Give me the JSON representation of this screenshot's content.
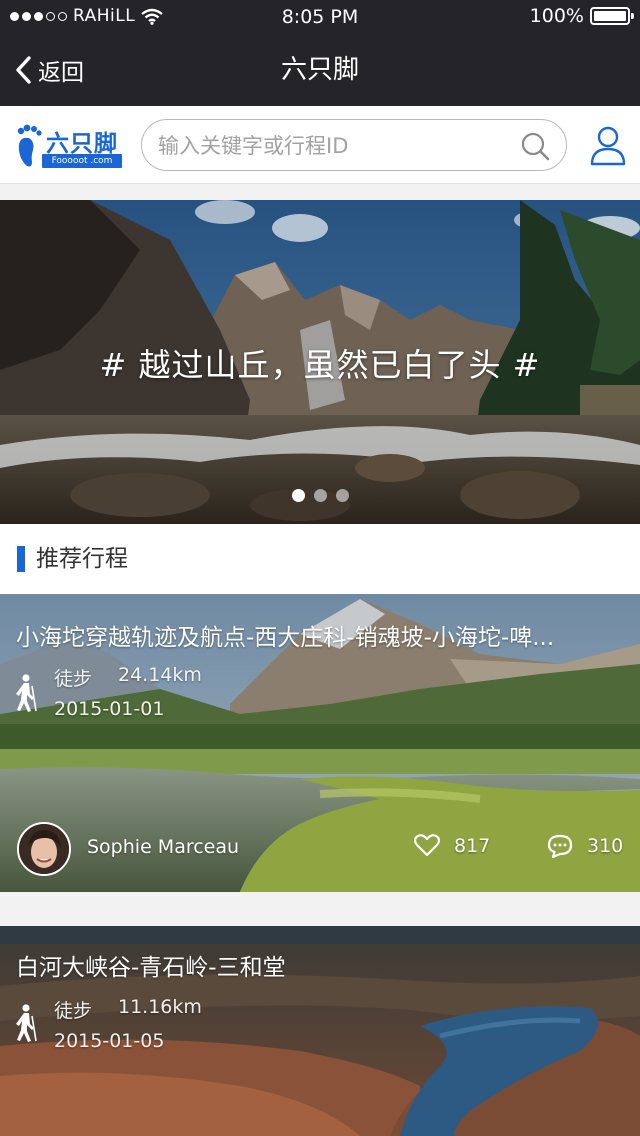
{
  "status_bar": {
    "carrier": "RAHiLL",
    "time": "8:05 PM",
    "battery": "100%",
    "battery_level": 1.0,
    "signal_bars": 3
  },
  "nav": {
    "back_label": "返回",
    "title": "六只脚"
  },
  "logo": {
    "text": "六只脚",
    "sub": "Fooooot .com"
  },
  "search": {
    "placeholder": "输入关键字或行程ID"
  },
  "banner": {
    "caption": "# 越过山丘，虽然已白了头 #",
    "page_count": 3,
    "active_page": 1
  },
  "section": {
    "title": "推荐行程"
  },
  "trips": [
    {
      "title": "小海坨穿越轨迹及航点-西大庄科-销魂坡-小海坨-啤...",
      "type": "徒步",
      "distance": "24.14km",
      "date": "2015-01-01",
      "author": "Sophie Marceau",
      "likes": "817",
      "comments": "310"
    },
    {
      "title": "白河大峡谷-青石岭-三和堂",
      "type": "徒步",
      "distance": "11.16km",
      "date": "2015-01-05"
    }
  ],
  "colors": {
    "nav_background": "#252529",
    "accent_blue": "#1a66d6",
    "page_background": "#f2f2f2"
  }
}
